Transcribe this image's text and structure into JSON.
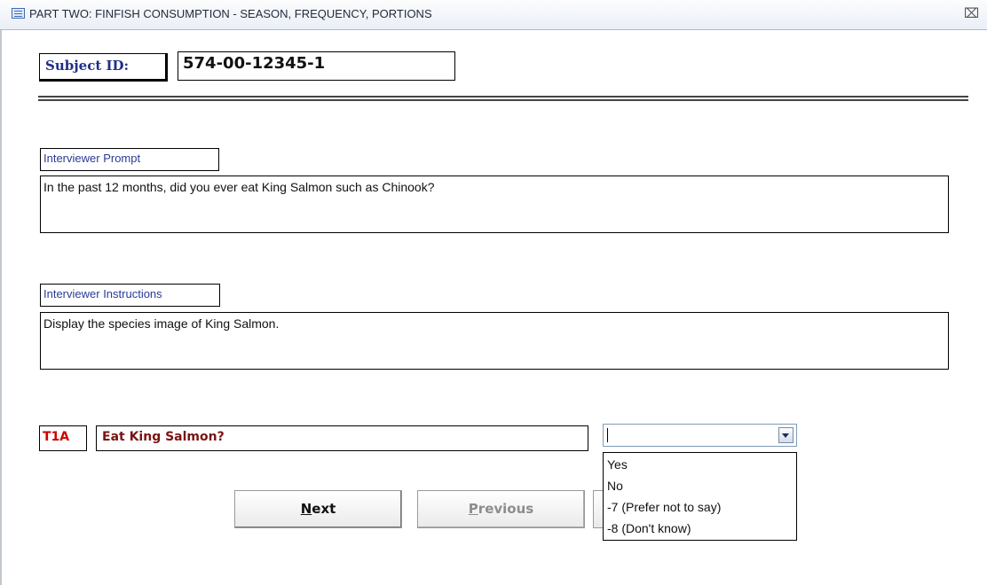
{
  "window": {
    "title": "PART TWO: FINFISH CONSUMPTION - SEASON, FREQUENCY, PORTIONS",
    "close_glyph": "⌧"
  },
  "subject": {
    "label": "Subject ID:",
    "value": "574-00-12345-1"
  },
  "prompt": {
    "label": "Interviewer Prompt",
    "text": "In the past 12 months, did you ever eat King Salmon such as Chinook?"
  },
  "instructions": {
    "label": "Interviewer Instructions",
    "text": "Display the species image of King Salmon."
  },
  "question": {
    "code": "T1A",
    "text": "Eat King Salmon?",
    "answer_value": "",
    "options": [
      {
        "label": "Yes"
      },
      {
        "label": "No"
      },
      {
        "label": "-7 (Prefer not to say)"
      },
      {
        "label": "-8 (Don't know)"
      }
    ]
  },
  "buttons": {
    "next_mnemonic": "N",
    "next_rest": "ext",
    "previous_mnemonic": "P",
    "previous_rest": "revious"
  },
  "colors": {
    "label_blue": "#2a3b95",
    "question_code_red": "#cc0000",
    "question_text_maroon": "#7a1313",
    "disabled_gray": "#8d8d8d"
  }
}
